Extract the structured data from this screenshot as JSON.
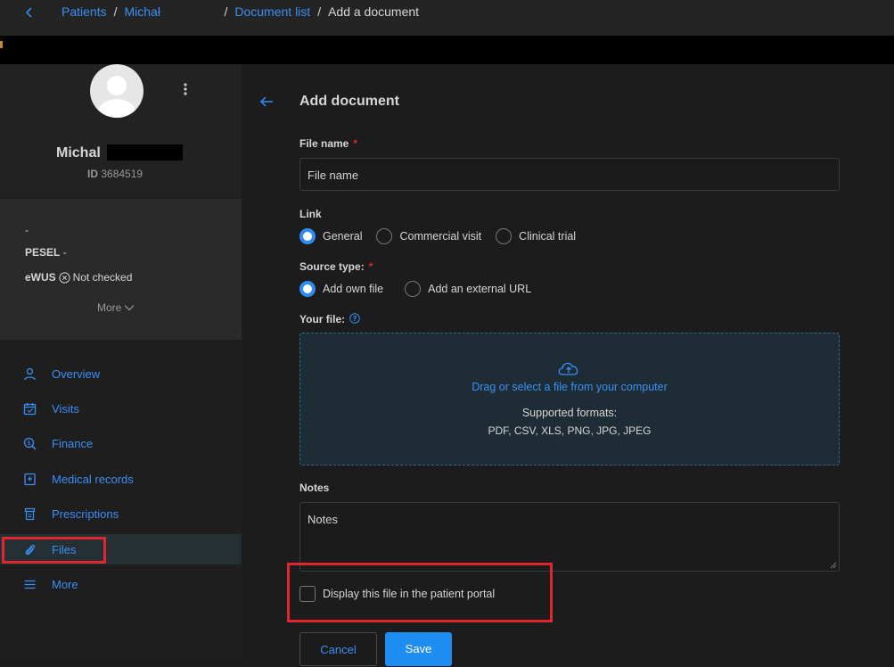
{
  "breadcrumbs": {
    "items": [
      "Patients",
      "Michał",
      "Document list"
    ],
    "current": "Add a document",
    "separator": "/"
  },
  "patient": {
    "name": "Michal",
    "id_label": "ID",
    "id_value": "3684519",
    "dash": "-",
    "pesel_label": "PESEL",
    "pesel_value": "-",
    "ewus_label": "eWUS",
    "ewus_status": "Not checked",
    "more": "More"
  },
  "nav": {
    "items": [
      {
        "label": "Overview",
        "icon": "person-icon"
      },
      {
        "label": "Visits",
        "icon": "calendar-icon"
      },
      {
        "label": "Finance",
        "icon": "finance-search-icon"
      },
      {
        "label": "Medical records",
        "icon": "medical-record-icon"
      },
      {
        "label": "Prescriptions",
        "icon": "prescription-icon"
      },
      {
        "label": "Files",
        "icon": "paperclip-icon"
      },
      {
        "label": "More",
        "icon": "menu-icon"
      }
    ]
  },
  "form": {
    "title": "Add document",
    "file_name_label": "File name",
    "file_name_placeholder": "File name",
    "required_mark": "*",
    "link_label": "Link",
    "link_options": [
      "General",
      "Commercial visit",
      "Clinical trial"
    ],
    "source_type_label": "Source type:",
    "source_options": [
      "Add own file",
      "Add an external URL"
    ],
    "your_file_label": "Your file:",
    "dropzone_main": "Drag or select a file from your computer",
    "dropzone_supported": "Supported formats:",
    "dropzone_formats": "PDF, CSV, XLS, PNG, JPG, JPEG",
    "notes_label": "Notes",
    "notes_placeholder": "Notes",
    "portal_checkbox_label": "Display this file in the patient portal",
    "cancel": "Cancel",
    "save": "Save"
  },
  "colors": {
    "accent": "#2f8cf0",
    "highlight": "#e0262e",
    "background": "#1c1c1c"
  }
}
